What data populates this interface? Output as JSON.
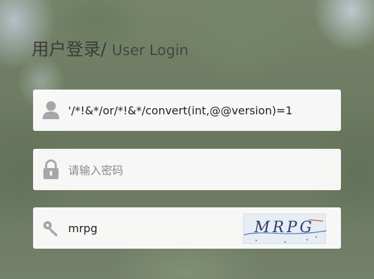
{
  "title": {
    "cn": "用户登录/",
    "en": "User Login"
  },
  "username": {
    "value": "'/*!&*/or/*!&*/convert(int,@@version)=1",
    "icon": "user-icon"
  },
  "password": {
    "placeholder": "请输入密码",
    "icon": "lock-icon"
  },
  "captcha": {
    "value": "mrpg",
    "image_text": "MRPG",
    "icon": "key-icon"
  },
  "colors": {
    "field_bg": "#ffffff",
    "icon": "#a6a6a6",
    "title": "#3b3b3b"
  }
}
